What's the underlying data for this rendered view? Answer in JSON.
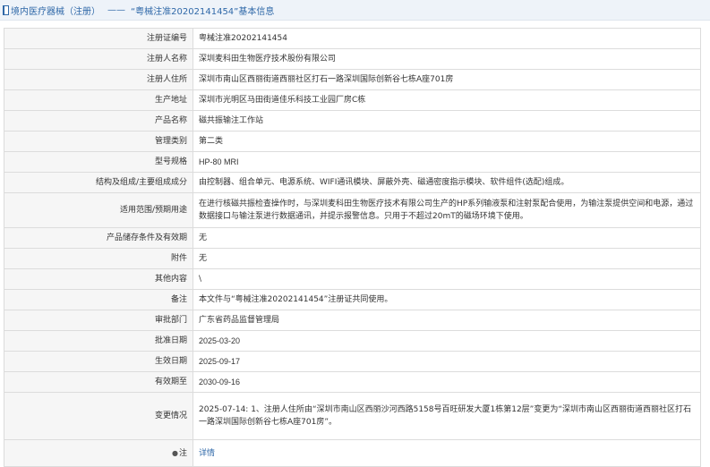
{
  "header": {
    "title": "境内医疗器械（注册）",
    "separator": "——",
    "subtitle": "“粤械注准20202141454”基本信息"
  },
  "rows": [
    {
      "label": "注册证编号",
      "value": "粤械注准20202141454"
    },
    {
      "label": "注册人名称",
      "value": "深圳麦科田生物医疗技术股份有限公司"
    },
    {
      "label": "注册人住所",
      "value": "深圳市南山区西丽街道西丽社区打石一路深圳国际创新谷七栋A座701房"
    },
    {
      "label": "生产地址",
      "value": "深圳市光明区马田街道佳乐科技工业园厂房C栋"
    },
    {
      "label": "产品名称",
      "value": "磁共振输注工作站"
    },
    {
      "label": "管理类别",
      "value": "第二类"
    },
    {
      "label": "型号规格",
      "value": "HP-80 MRI"
    },
    {
      "label": "结构及组成/主要组成成分",
      "value": "由控制器、组合单元、电源系统、WIFI通讯模块、屏蔽外壳、磁通密度指示模块、软件组件(选配)组成。"
    },
    {
      "label": "适用范围/预期用途",
      "value": "在进行核磁共振检查操作时，与深圳麦科田生物医疗技术有限公司生产的HP系列输液泵和注射泵配合使用，为输注泵提供空间和电源，通过数据接口与输注泵进行数据通讯，并提示报警信息。只用于不超过20mT的磁场环境下使用。"
    },
    {
      "label": "产品储存条件及有效期",
      "value": "无"
    },
    {
      "label": "附件",
      "value": "无"
    },
    {
      "label": "其他内容",
      "value": "\\"
    },
    {
      "label": "备注",
      "value": "本文件与“粤械注准20202141454”注册证共同使用。"
    },
    {
      "label": "审批部门",
      "value": "广东省药品监督管理局"
    },
    {
      "label": "批准日期",
      "value": "2025-03-20"
    },
    {
      "label": "生效日期",
      "value": "2025-09-17"
    },
    {
      "label": "有效期至",
      "value": "2030-09-16"
    },
    {
      "label": "变更情况",
      "value": "2025-07-14: 1、注册人住所由“深圳市南山区西丽沙河西路5158号百旺研发大厦1栋第12层”变更为“深圳市南山区西丽街道西丽社区打石一路深圳国际创新谷七栋A座701房”。"
    },
    {
      "label": "注",
      "value": "详情"
    }
  ]
}
